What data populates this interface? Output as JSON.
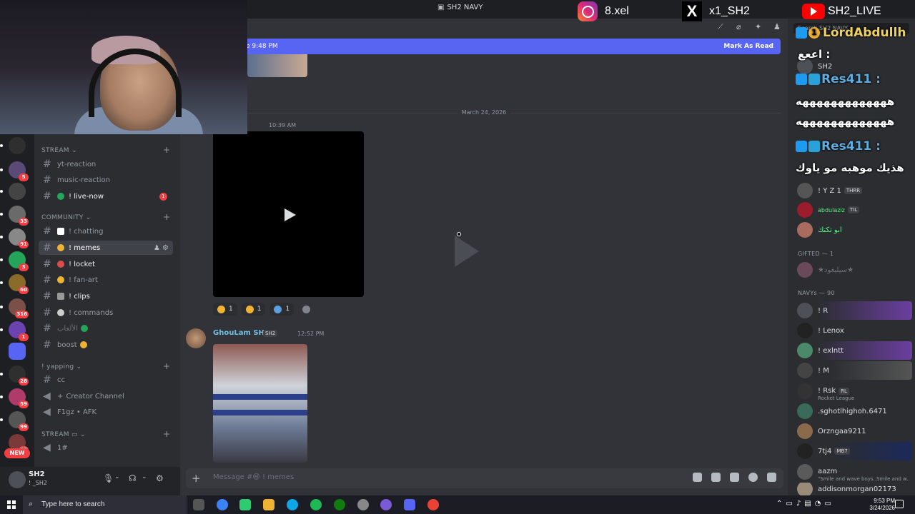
{
  "window": {
    "title": "SH2 NAVY"
  },
  "socials": [
    {
      "icon": "instagram-icon",
      "handle": "8.xel"
    },
    {
      "icon": "x-icon",
      "handle": "x1_SH2"
    },
    {
      "icon": "youtube-icon",
      "handle": "SH2_LIVE"
    }
  ],
  "rail": {
    "badges": [
      "5",
      "33",
      "91",
      "3",
      "60",
      "316",
      "1",
      "28",
      "59",
      "99",
      "45"
    ],
    "new_label": "NEW"
  },
  "sidebar": {
    "cat_stream": "STREAM",
    "cat_community": "COMMUNITY",
    "cat_yapping": "! yapping",
    "cat_stream2": "STREAM",
    "channels": [
      {
        "label": "yt-reaction"
      },
      {
        "label": "music-reaction"
      },
      {
        "label": "! live-now",
        "badge": "1"
      },
      {
        "label": "! chatting"
      },
      {
        "label": "! memes"
      },
      {
        "label": "! locket"
      },
      {
        "label": "! fan-art"
      },
      {
        "label": "! clips"
      },
      {
        "label": "! commands"
      },
      {
        "label": "الألعاب"
      },
      {
        "label": "boost"
      },
      {
        "label": "cc"
      },
      {
        "label": "Creator Channel"
      },
      {
        "label": "F1gz • AFK"
      },
      {
        "label": "1#"
      }
    ]
  },
  "user": {
    "name": "SH2",
    "status": "! _SH2"
  },
  "chat": {
    "newbar_left": "e 9:48 PM",
    "newbar_right": "Mark As Read",
    "date_divider": "March 24, 2026",
    "video_time": "10:39 AM",
    "reactions": [
      {
        "count": "1",
        "color": "#f0b232"
      },
      {
        "count": "1",
        "color": "#f0b232"
      },
      {
        "count": "1",
        "color": "#5aa0e0"
      }
    ],
    "msg_author": "GhouLam SH2",
    "msg_tag": "SH2",
    "msg_time": "12:52 PM",
    "composer_placeholder": "Message #😄 ! memes"
  },
  "members": {
    "search_placeholder": "Search SH2 NAVY",
    "top": [
      {
        "name": "SH2"
      },
      {
        "name": "! Y Z 1",
        "tag": "THRR"
      },
      {
        "name": "abdulaziz",
        "tag": "TIL"
      },
      {
        "name": "أبو تكتك"
      }
    ],
    "cat_gifted": "GIFTED — 1",
    "gifted": [
      {
        "name": "★سيليغود★"
      }
    ],
    "cat_navys": "NAVYs — 90",
    "navys": [
      {
        "name": "! R"
      },
      {
        "name": "! Lenox"
      },
      {
        "name": "! exlntt"
      },
      {
        "name": "! M"
      },
      {
        "name": "! Rsk",
        "tag": "RL",
        "sub": "Rocket League"
      },
      {
        "name": ".sghotlhighoh.6471"
      },
      {
        "name": "Orzngaa9211"
      },
      {
        "name": "7tj4",
        "tag": "MB7"
      },
      {
        "name": "aazm",
        "sub": "\"Smile and wave boys..Smile and w..."
      },
      {
        "name": "addisonmorgan02173"
      }
    ]
  },
  "overlay": [
    {
      "name": "LordAbdullh",
      "text": "اععع :"
    },
    {
      "name": "Res411 :",
      "text": "هههههههههههههه"
    },
    {
      "text": "هههههههههههههه"
    },
    {
      "name": "Res411 :",
      "text": "هذيك موهبه مو ياوك"
    }
  ],
  "taskbar": {
    "search_placeholder": "Type here to search",
    "time": "9:53 PM",
    "date": "3/24/2026"
  }
}
